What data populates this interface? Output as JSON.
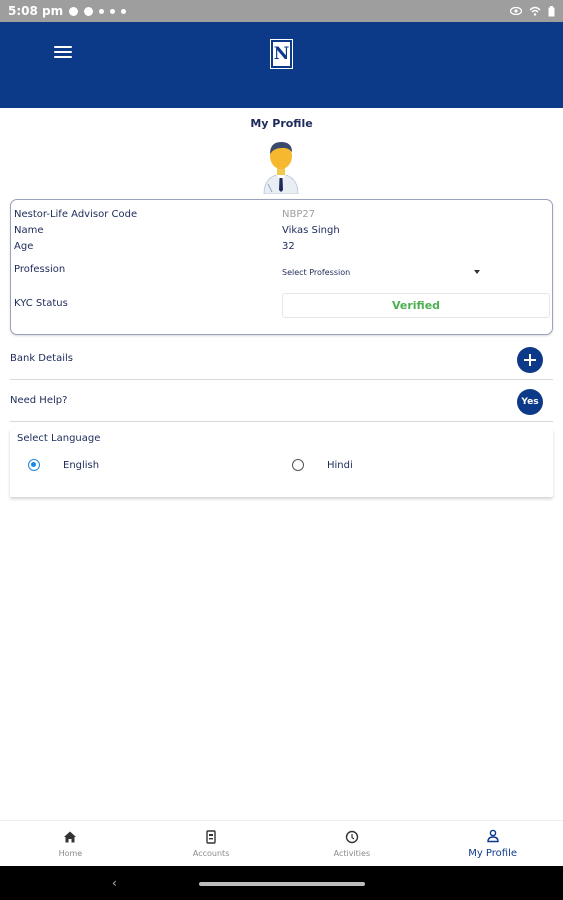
{
  "status_bar": {
    "time": "5:08 pm"
  },
  "header": {
    "logo_letter": "N"
  },
  "page_title": "My Profile",
  "profile": {
    "advisor_code_label": "Nestor-Life Advisor Code",
    "advisor_code_value": "NBP27",
    "name_label": "Name",
    "name_value": "Vikas Singh",
    "age_label": "Age",
    "age_value": "32",
    "profession_label": "Profession",
    "profession_placeholder": "Select Profession",
    "kyc_label": "KYC Status",
    "kyc_value": "Verified"
  },
  "bank_details": {
    "label": "Bank Details"
  },
  "need_help": {
    "label": "Need Help?",
    "button": "Yes"
  },
  "language": {
    "title": "Select Language",
    "options": [
      {
        "label": "English",
        "selected": true
      },
      {
        "label": "Hindi",
        "selected": false
      }
    ]
  },
  "bottom_nav": {
    "items": [
      {
        "label": "Home",
        "icon": "home-icon",
        "active": false
      },
      {
        "label": "Accounts",
        "icon": "accounts-icon",
        "active": false
      },
      {
        "label": "Activities",
        "icon": "activities-icon",
        "active": false
      },
      {
        "label": "My Profile",
        "icon": "profile-icon",
        "active": true
      }
    ]
  },
  "colors": {
    "brand": "#0d3989",
    "verified": "#4caf50",
    "radio_selected": "#1e88e5"
  }
}
